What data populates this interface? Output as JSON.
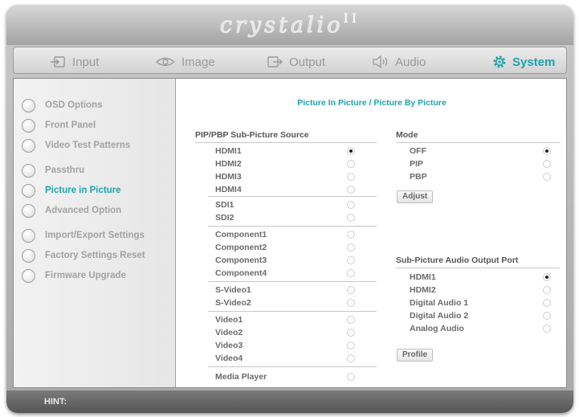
{
  "logo": {
    "text": "crystalio",
    "suffix": "II"
  },
  "tabs": [
    {
      "label": "Input",
      "icon": "input-icon"
    },
    {
      "label": "Image",
      "icon": "eye-icon"
    },
    {
      "label": "Output",
      "icon": "output-icon"
    },
    {
      "label": "Audio",
      "icon": "speaker-icon"
    },
    {
      "label": "System",
      "icon": "gear-icon",
      "active": true
    }
  ],
  "sidebar": {
    "items": [
      {
        "label": "OSD Options"
      },
      {
        "label": "Front Panel"
      },
      {
        "label": "Video Test Patterns"
      },
      {
        "label": "Passthru"
      },
      {
        "label": "Picture in Picture",
        "active": true
      },
      {
        "label": "Advanced Option"
      },
      {
        "label": "Import/Export Settings"
      },
      {
        "label": "Factory Settings Reset"
      },
      {
        "label": "Firmware Upgrade"
      }
    ]
  },
  "main": {
    "title": "Picture In Picture / Picture By Picture",
    "source": {
      "heading": "PIP/PBP Sub-Picture Source",
      "selected": "HDMI1",
      "options": [
        "HDMI1",
        "HDMI2",
        "HDMI3",
        "HDMI4",
        "SDI1",
        "SDI2",
        "Component1",
        "Component2",
        "Component3",
        "Component4",
        "S-Video1",
        "S-Video2",
        "Video1",
        "Video2",
        "Video3",
        "Video4",
        "Media Player"
      ]
    },
    "mode": {
      "heading": "Mode",
      "selected": "OFF",
      "options": [
        "OFF",
        "PIP",
        "PBP"
      ],
      "adjust_label": "Adjust"
    },
    "audio": {
      "heading": "Sub-Picture Audio Output Port",
      "selected": "HDMI1",
      "options": [
        "HDMI1",
        "HDMI2",
        "Digital Audio 1",
        "Digital Audio 2",
        "Analog Audio"
      ],
      "profile_label": "Profile"
    }
  },
  "hint": {
    "label": "HINT:"
  },
  "colors": {
    "accent": "#1fa2ac"
  }
}
